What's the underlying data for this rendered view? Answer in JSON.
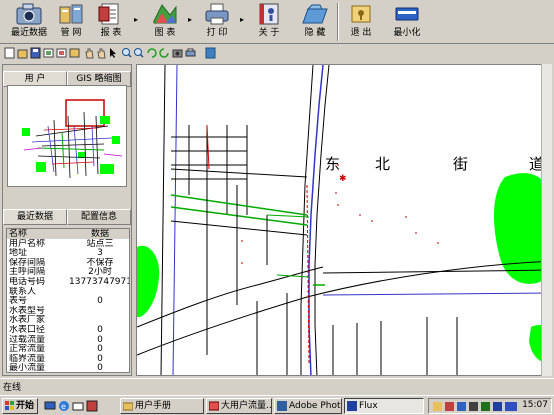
{
  "toolbar": {
    "recent_data": "最近数据",
    "pipe_network": "管 网",
    "report": "报 表",
    "chart": "图 表",
    "print": "打 印",
    "about": "关 于",
    "hide": "隐 藏",
    "exit": "退 出",
    "minimize": "最小化"
  },
  "left_panel": {
    "top_tabs": [
      "用 户",
      "GIS 略缩图"
    ],
    "bottom_tabs": [
      "最近数据",
      "配置信息"
    ],
    "grid_header": [
      "名称",
      "数据"
    ],
    "grid_rows": [
      [
        "用户名称",
        "站点三"
      ],
      [
        "地址",
        "3"
      ],
      [
        "保存间隔",
        "不保存"
      ],
      [
        "主呼间隔",
        "2小时"
      ],
      [
        "电话号码",
        "13773747971"
      ],
      [
        "联系人",
        ""
      ],
      [
        "表号",
        "0"
      ],
      [
        "水表型号",
        ""
      ],
      [
        "水表厂家",
        ""
      ],
      [
        "水表口径",
        "0"
      ],
      [
        "过载流量",
        "0"
      ],
      [
        "正常流量",
        "0"
      ],
      [
        "临界流量",
        "0"
      ],
      [
        "最小流量",
        "0"
      ]
    ]
  },
  "map": {
    "street_chars": [
      "东",
      "北",
      "街",
      "道"
    ]
  },
  "status_bar": {
    "text": "在线"
  },
  "taskbar": {
    "start": "开始",
    "tasks": [
      "用户手册",
      "大用户流量...",
      "Adobe Photos...",
      "Flux"
    ],
    "clock": "15:07"
  },
  "colors": {
    "road_blue": "#3333cc",
    "road_black": "#000000",
    "pipe_green": "#00aa00",
    "area_green": "#00ff00",
    "pipe_red": "#dd0000",
    "face": "#d4d0c8"
  }
}
